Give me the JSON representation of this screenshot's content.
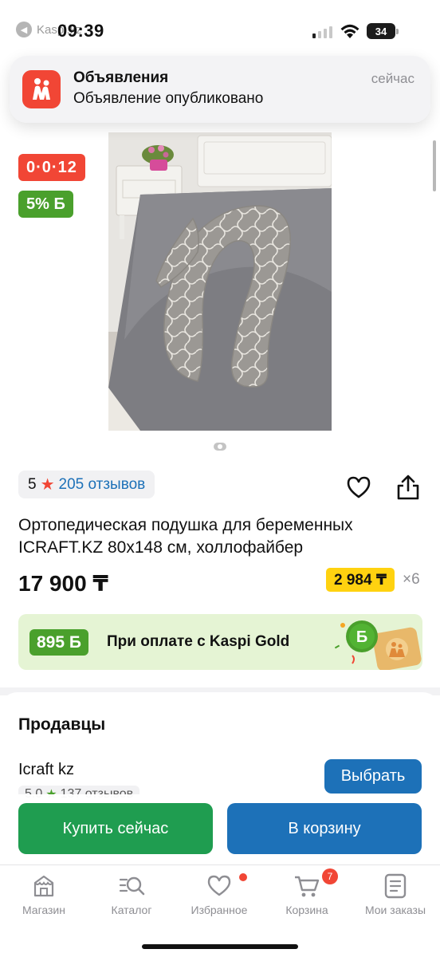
{
  "status_bar": {
    "back_app": "Kaspi.kz",
    "time": "09:39",
    "battery": "34"
  },
  "notification": {
    "app": "Объявления",
    "text": "Объявление опубликовано",
    "time": "сейчас",
    "icon": "kaspi-ads-icon"
  },
  "product": {
    "timer_badge": "0·0·12",
    "bonus_badge": "5% Б",
    "rating": "5",
    "reviews": "205 отзывов",
    "title": "Ортопедическая подушка для беременных ICRAFT.KZ 80x148 см, холлофайбер",
    "price": "17 900 ₸",
    "installment": "2 984 ₸",
    "installment_months": "×6",
    "gold_bonus": "895 Б",
    "gold_text": "При оплате с Kaspi Gold",
    "image": "u-shaped-pregnancy-pillow-photo",
    "image_count": 1
  },
  "sellers": {
    "title": "Продавцы",
    "first": {
      "name": "Icraft kz",
      "rating": "5.0",
      "reviews": "137 отзывов",
      "choose_label": "Выбрать"
    }
  },
  "actions": {
    "buy_now": "Купить сейчас",
    "add_to_cart": "В корзину"
  },
  "tabbar": {
    "items": [
      {
        "label": "Магазин",
        "icon": "shop-icon"
      },
      {
        "label": "Каталог",
        "icon": "catalog-search-icon"
      },
      {
        "label": "Избранное",
        "icon": "heart-icon",
        "dot": true
      },
      {
        "label": "Корзина",
        "icon": "cart-icon",
        "count": "7"
      },
      {
        "label": "Мои заказы",
        "icon": "orders-icon"
      }
    ]
  },
  "colors": {
    "kaspi_red": "#f14635",
    "kaspi_blue": "#1d71b8",
    "kaspi_green": "#1f9d50",
    "bonus_green": "#4aa02c",
    "installment_yellow": "#ffd210"
  }
}
